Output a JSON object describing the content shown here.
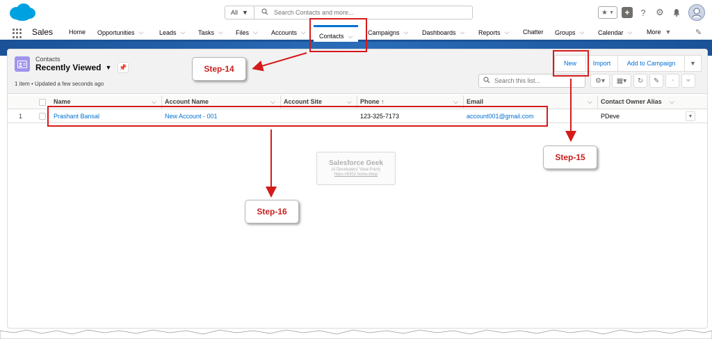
{
  "header": {
    "search_scope": "All",
    "search_placeholder": "Search Contacts and more..."
  },
  "nav": {
    "app_name": "Sales",
    "items": [
      {
        "label": "Home",
        "has_menu": false
      },
      {
        "label": "Opportunities",
        "has_menu": true
      },
      {
        "label": "Leads",
        "has_menu": true
      },
      {
        "label": "Tasks",
        "has_menu": true
      },
      {
        "label": "Files",
        "has_menu": true
      },
      {
        "label": "Accounts",
        "has_menu": true
      },
      {
        "label": "Contacts",
        "has_menu": true,
        "active": true
      },
      {
        "label": "Campaigns",
        "has_menu": true
      },
      {
        "label": "Dashboards",
        "has_menu": true
      },
      {
        "label": "Reports",
        "has_menu": true
      },
      {
        "label": "Chatter",
        "has_menu": false
      },
      {
        "label": "Groups",
        "has_menu": true
      },
      {
        "label": "Calendar",
        "has_menu": true
      },
      {
        "label": "More",
        "has_menu": true
      }
    ]
  },
  "list_view": {
    "object_label": "Contacts",
    "view_name": "Recently Viewed",
    "meta": "1 item • Updated a few seconds ago",
    "buttons": {
      "new": "New",
      "import": "Import",
      "add_to_campaign": "Add to Campaign"
    },
    "search_placeholder": "Search this list..."
  },
  "table": {
    "columns": [
      "Name",
      "Account Name",
      "Account Site",
      "Phone",
      "Email",
      "Contact Owner Alias"
    ],
    "sorted_column_indicator": "↑",
    "rows": [
      {
        "num": "1",
        "name": "Prashant Bansal",
        "account_name": "New Account - 001",
        "account_site": "",
        "phone": "123-325-7173",
        "email": "account001@gmail.com",
        "owner_alias": "PDeve"
      }
    ]
  },
  "watermark": {
    "title": "Salesforce Geek",
    "subtitle": "(A Developers' View Point)",
    "url": "https://6302.home.blog/"
  },
  "annotations": {
    "step14": "Step-14",
    "step15": "Step-15",
    "step16": "Step-16"
  },
  "colors": {
    "brand_blue": "#0070d2",
    "nav_band": "#1b5297",
    "annotation_red": "#d41a1a",
    "contact_icon": "#a094ed"
  }
}
